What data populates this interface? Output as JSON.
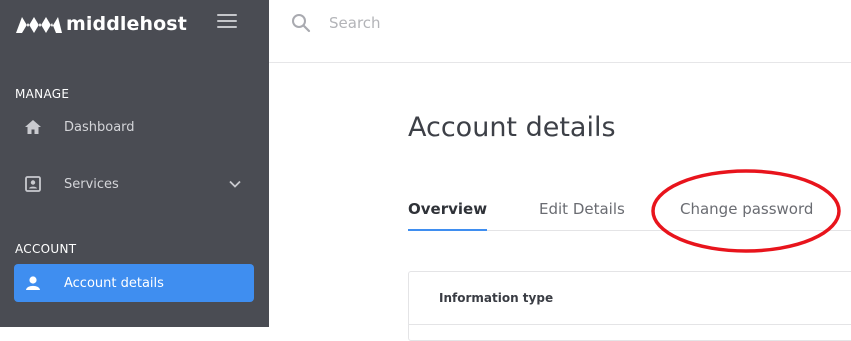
{
  "brand": {
    "name": "middlehost",
    "logo_icon": "middlehost-logo-icon"
  },
  "header": {
    "menu_icon": "hamburger-menu-icon"
  },
  "search": {
    "placeholder": "Search",
    "icon": "search-icon"
  },
  "sidebar": {
    "sections": [
      {
        "label": "MANAGE"
      },
      {
        "label": "ACCOUNT"
      }
    ],
    "items": [
      {
        "label": "Dashboard",
        "icon": "home-icon",
        "active": false
      },
      {
        "label": "Services",
        "icon": "contact-card-icon",
        "active": false,
        "expandable": true
      },
      {
        "label": "Account details",
        "icon": "user-icon",
        "active": true
      }
    ]
  },
  "main": {
    "title": "Account details",
    "tabs": [
      {
        "label": "Overview",
        "active": true
      },
      {
        "label": "Edit Details",
        "active": false
      },
      {
        "label": "Change password",
        "active": false,
        "annotated": true
      }
    ],
    "table": {
      "header": "Information type"
    }
  },
  "colors": {
    "sidebar_bg": "#4a4c53",
    "accent": "#3f8ef0",
    "annotation": "#e8141c"
  }
}
